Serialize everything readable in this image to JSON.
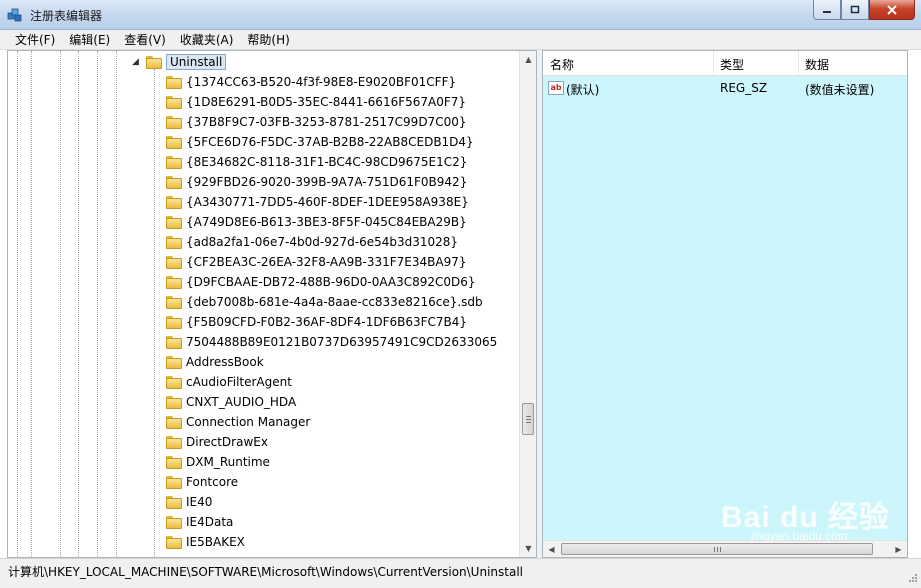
{
  "window": {
    "title": "注册表编辑器",
    "icon": "registry-editor-icon"
  },
  "menu": [
    {
      "label": "文件(F)"
    },
    {
      "label": "编辑(E)"
    },
    {
      "label": "查看(V)"
    },
    {
      "label": "收藏夹(A)"
    },
    {
      "label": "帮助(H)"
    }
  ],
  "tree": {
    "selected": {
      "label": "Uninstall"
    },
    "children": [
      {
        "label": "{1374CC63-B520-4f3f-98E8-E9020BF01CFF}"
      },
      {
        "label": "{1D8E6291-B0D5-35EC-8441-6616F567A0F7}"
      },
      {
        "label": "{37B8F9C7-03FB-3253-8781-2517C99D7C00}"
      },
      {
        "label": "{5FCE6D76-F5DC-37AB-B2B8-22AB8CEDB1D4}"
      },
      {
        "label": "{8E34682C-8118-31F1-BC4C-98CD9675E1C2}"
      },
      {
        "label": "{929FBD26-9020-399B-9A7A-751D61F0B942}"
      },
      {
        "label": "{A3430771-7DD5-460F-8DEF-1DEE958A938E}"
      },
      {
        "label": "{A749D8E6-B613-3BE3-8F5F-045C84EBA29B}"
      },
      {
        "label": "{ad8a2fa1-06e7-4b0d-927d-6e54b3d31028}"
      },
      {
        "label": "{CF2BEA3C-26EA-32F8-AA9B-331F7E34BA97}"
      },
      {
        "label": "{D9FCBAAE-DB72-488B-96D0-0AA3C892C0D6}"
      },
      {
        "label": "{deb7008b-681e-4a4a-8aae-cc833e8216ce}.sdb"
      },
      {
        "label": "{F5B09CFD-F0B2-36AF-8DF4-1DF6B63FC7B4}"
      },
      {
        "label": "7504488B89E0121B0737D63957491C9CD2633065"
      },
      {
        "label": "AddressBook"
      },
      {
        "label": "cAudioFilterAgent"
      },
      {
        "label": "CNXT_AUDIO_HDA"
      },
      {
        "label": "Connection Manager"
      },
      {
        "label": "DirectDrawEx"
      },
      {
        "label": "DXM_Runtime"
      },
      {
        "label": "Fontcore"
      },
      {
        "label": "IE40"
      },
      {
        "label": "IE4Data"
      },
      {
        "label": "IE5BAKEX"
      }
    ]
  },
  "values": {
    "columns": {
      "name": "名称",
      "type": "类型",
      "data": "数据"
    },
    "rows": [
      {
        "name": "(默认)",
        "type": "REG_SZ",
        "data": "(数值未设置)",
        "icon": "string-value-icon",
        "icon_text": "ab"
      }
    ]
  },
  "status": {
    "path": "计算机\\HKEY_LOCAL_MACHINE\\SOFTWARE\\Microsoft\\Windows\\CurrentVersion\\Uninstall"
  },
  "watermark": {
    "main": "Bai du 经验",
    "sub": "jingyan.baidu.com"
  },
  "colors": {
    "value_pane_bg": "#ccf6fb",
    "title_gradient": "#c3d6ee",
    "folder": "#e9bd3d"
  }
}
